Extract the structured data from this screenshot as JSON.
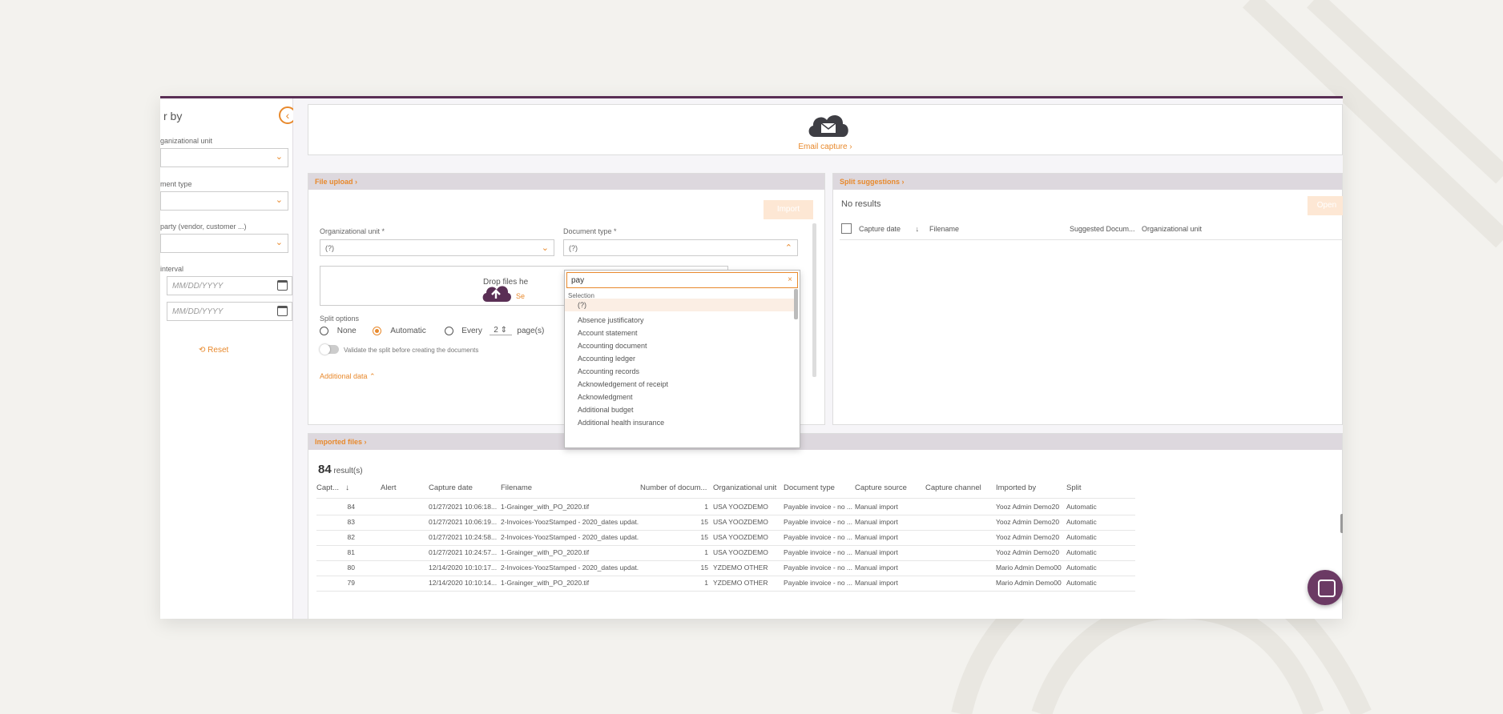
{
  "sidebar": {
    "title": "r by",
    "filters": [
      {
        "label": "ganizational unit"
      },
      {
        "label": "ment type"
      },
      {
        "label": "party (vendor, customer ...)"
      },
      {
        "label": "interval"
      }
    ],
    "date_from_placeholder": "MM/DD/YYYY",
    "date_to_placeholder": "MM/DD/YYYY",
    "reset_label": "Reset"
  },
  "email_capture": {
    "label": "Email capture"
  },
  "file_upload": {
    "title": "File upload",
    "import_button": "Import",
    "org_unit_label": "Organizational unit *",
    "org_unit_value": "(?)",
    "doc_type_label": "Document type *",
    "doc_type_value": "(?)",
    "drop_text": "Drop files he",
    "drop_link": "Se",
    "split_options_label": "Split options",
    "split_none": "None",
    "split_automatic": "Automatic",
    "split_every": "Every",
    "split_pages_value": "2",
    "split_pages_unit": "page(s)",
    "validate_label": "Validate the split before creating the documents",
    "additional_data": "Additional data"
  },
  "doc_type_dropdown": {
    "search_value": "pay",
    "section_label": "Selection",
    "items": [
      "(?)",
      "Absence justificatory",
      "Account statement",
      "Accounting document",
      "Accounting ledger",
      "Accounting records",
      "Acknowledgement of receipt",
      "Acknowledgment",
      "Additional budget",
      "Additional health insurance"
    ]
  },
  "split_suggestions": {
    "title": "Split suggestions",
    "no_results": "No results",
    "open_button": "Open",
    "columns": [
      "Capture date",
      "Filename",
      "Suggested Docum...",
      "Organizational unit"
    ]
  },
  "imported_files": {
    "title": "Imported files",
    "count": "84",
    "count_suffix": "result(s)",
    "columns": [
      "Capt...",
      "Alert",
      "Capture date",
      "Filename",
      "Number of docum...",
      "Organizational unit",
      "Document type",
      "Capture source",
      "Capture channel",
      "Imported by",
      "Split"
    ],
    "rows": [
      [
        "84",
        "",
        "01/27/2021 10:06:18...",
        "1-Grainger_with_PO_2020.tif",
        "1",
        "USA YOOZDEMO",
        "Payable invoice - no ...",
        "Manual import",
        "",
        "Yooz Admin Demo20",
        "Automatic"
      ],
      [
        "83",
        "",
        "01/27/2021 10:06:19...",
        "2-Invoices-YoozStamped - 2020_dates updat...",
        "15",
        "USA YOOZDEMO",
        "Payable invoice - no ...",
        "Manual import",
        "",
        "Yooz Admin Demo20",
        "Automatic"
      ],
      [
        "82",
        "",
        "01/27/2021 10:24:58...",
        "2-Invoices-YoozStamped - 2020_dates updat...",
        "15",
        "USA YOOZDEMO",
        "Payable invoice - no ...",
        "Manual import",
        "",
        "Yooz Admin Demo20",
        "Automatic"
      ],
      [
        "81",
        "",
        "01/27/2021 10:24:57...",
        "1-Grainger_with_PO_2020.tif",
        "1",
        "USA YOOZDEMO",
        "Payable invoice - no ...",
        "Manual import",
        "",
        "Yooz Admin Demo20",
        "Automatic"
      ],
      [
        "80",
        "",
        "12/14/2020 10:10:17...",
        "2-Invoices-YoozStamped - 2020_dates updat...",
        "15",
        "YZDEMO OTHER",
        "Payable invoice - no ...",
        "Manual import",
        "",
        "Mario Admin Demo00",
        "Automatic"
      ],
      [
        "79",
        "",
        "12/14/2020 10:10:14...",
        "1-Grainger_with_PO_2020.tif",
        "1",
        "YZDEMO OTHER",
        "Payable invoice - no ...",
        "Manual import",
        "",
        "Mario Admin Demo00",
        "Automatic"
      ]
    ]
  },
  "colors": {
    "accent": "#e8892c",
    "brand": "#5a2f55",
    "panel_header": "#ddd8de"
  }
}
